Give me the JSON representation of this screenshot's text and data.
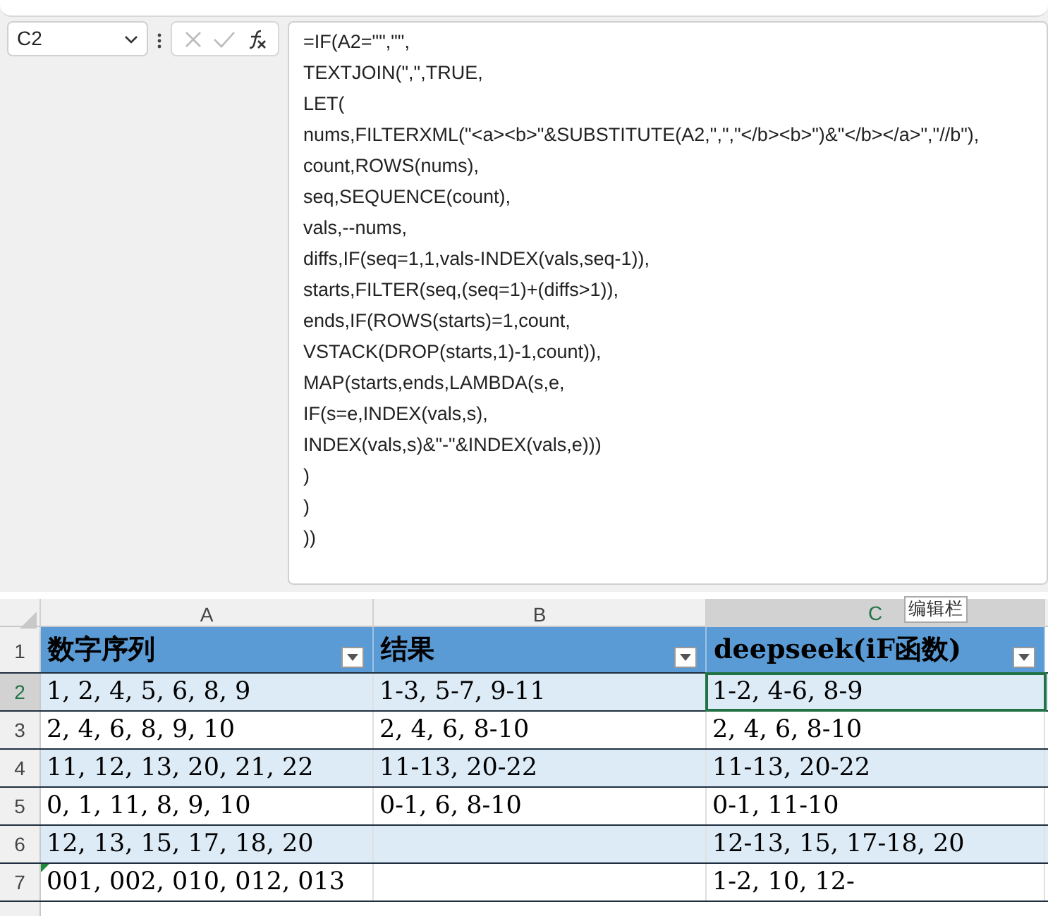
{
  "name_box": {
    "value": "C2"
  },
  "formula_bar": {
    "lines": [
      "=IF(A2=\"\",\"\",",
      "TEXTJOIN(\",\",TRUE,",
      "LET(",
      "nums,FILTERXML(\"<a><b>\"&SUBSTITUTE(A2,\",\",\"</b><b>\")&\"</b></a>\",\"//b\"),",
      "count,ROWS(nums),",
      "seq,SEQUENCE(count),",
      "vals,--nums,",
      "diffs,IF(seq=1,1,vals-INDEX(vals,seq-1)),",
      "starts,FILTER(seq,(seq=1)+(diffs>1)),",
      "ends,IF(ROWS(starts)=1,count,",
      "VSTACK(DROP(starts,1)-1,count)),",
      "MAP(starts,ends,LAMBDA(s,e,",
      "IF(s=e,INDEX(vals,s),",
      "INDEX(vals,s)&\"-\"&INDEX(vals,e)))",
      ")",
      ")",
      "))"
    ]
  },
  "columns": [
    {
      "label": "A",
      "selected": false
    },
    {
      "label": "B",
      "selected": false
    },
    {
      "label": "C",
      "selected": true
    }
  ],
  "tooltip": "编辑栏",
  "header_row": {
    "number": "1",
    "cells": [
      "数字序列",
      "结果",
      "deepseek(iF函数)"
    ]
  },
  "rows": [
    {
      "number": "2",
      "selected": true,
      "cells": [
        "1, 2, 4, 5, 6, 8, 9",
        "1-3, 5-7, 9-11",
        "1-2, 4-6, 8-9"
      ]
    },
    {
      "number": "3",
      "selected": false,
      "cells": [
        "2, 4, 6, 8, 9, 10",
        "2, 4, 6, 8-10",
        "2, 4, 6, 8-10"
      ]
    },
    {
      "number": "4",
      "selected": false,
      "cells": [
        "11, 12, 13, 20, 21, 22",
        "11-13, 20-22",
        "11-13, 20-22"
      ]
    },
    {
      "number": "5",
      "selected": false,
      "cells": [
        "0, 1, 11, 8, 9, 10",
        "0-1, 6, 8-10",
        "0-1, 11-10"
      ]
    },
    {
      "number": "6",
      "selected": false,
      "cells": [
        "12, 13, 15, 17, 18, 20",
        "",
        "12-13, 15, 17-18, 20"
      ]
    },
    {
      "number": "7",
      "selected": false,
      "error_flag": true,
      "cells": [
        "001, 002, 010, 012, 013",
        "",
        "1-2, 10, 12-"
      ]
    }
  ]
}
